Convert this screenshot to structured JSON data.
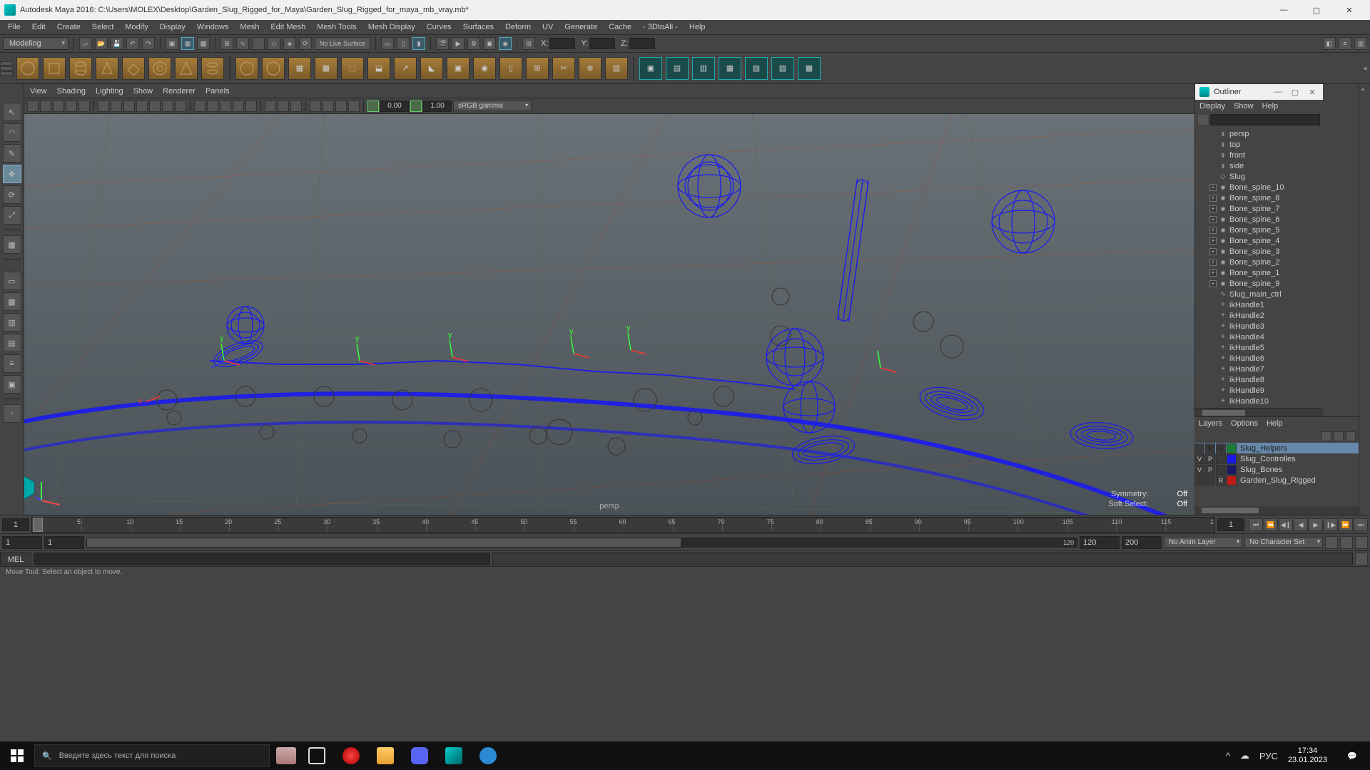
{
  "titlebar": {
    "title": "Autodesk Maya 2016: C:\\Users\\MOLEX\\Desktop\\Garden_Slug_Rigged_for_Maya\\Garden_Slug_Rigged_for_maya_mb_vray.mb*"
  },
  "main_menu": [
    "File",
    "Edit",
    "Create",
    "Select",
    "Modify",
    "Display",
    "Windows",
    "Mesh",
    "Edit Mesh",
    "Mesh Tools",
    "Mesh Display",
    "Curves",
    "Surfaces",
    "Deform",
    "UV",
    "Generate",
    "Cache",
    "- 3DtoAll -",
    "Help"
  ],
  "status": {
    "mode": "Modeling",
    "live": "No Live Surface",
    "coord_x": "X:",
    "coord_y": "Y:",
    "coord_z": "Z:",
    "x": "",
    "y": "",
    "z": ""
  },
  "viewport": {
    "menu": [
      "View",
      "Shading",
      "Lighting",
      "Show",
      "Renderer",
      "Panels"
    ],
    "num1": "0.00",
    "num2": "1.00",
    "colorspace": "sRGB gamma",
    "camera": "persp",
    "sym_label": "Symmetry:",
    "sym_val": "Off",
    "soft_label": "Soft Select:",
    "soft_val": "Off"
  },
  "outliner": {
    "title": "Outliner",
    "menu": [
      "Display",
      "Show",
      "Help"
    ],
    "cameras": [
      "persp",
      "top",
      "front",
      "side"
    ],
    "root": "Slug",
    "bones": [
      "Bone_spine_10",
      "Bone_spine_8",
      "Bone_spine_7",
      "Bone_spine_6",
      "Bone_spine_5",
      "Bone_spine_4",
      "Bone_spine_3",
      "Bone_spine_2",
      "Bone_spine_1",
      "Bone_spine_9"
    ],
    "ctrl": "Slug_main_ctrl",
    "iks": [
      "ikHandle1",
      "ikHandle2",
      "ikHandle3",
      "ikHandle4",
      "ikHandle5",
      "ikHandle6",
      "ikHandle7",
      "ikHandle8",
      "ikHandle9",
      "ikHandle10"
    ]
  },
  "layers": {
    "menu": [
      "Layers",
      "Options",
      "Help"
    ],
    "rows": [
      {
        "v": "",
        "p": "P",
        "r": "R",
        "color": "#1a7a3a",
        "name": "Slug_Helpers",
        "hl": true
      },
      {
        "v": "V",
        "p": "P",
        "r": "",
        "color": "#1a1aea",
        "name": "Slug_Controlles",
        "hl": false
      },
      {
        "v": "V",
        "p": "P",
        "r": "",
        "color": "#1a1a6a",
        "name": "Slug_Bones",
        "hl": false
      },
      {
        "v": "",
        "p": "",
        "r": "R",
        "color": "#c01a1a",
        "name": "Garden_Slug_Rigged",
        "hl": false
      }
    ]
  },
  "time": {
    "current": "1",
    "end": "1",
    "start_range": "1",
    "end_in": "1",
    "range_val": "120",
    "end_range": "120",
    "max_range": "200",
    "anim_layer": "No Anim Layer",
    "char_set": "No Character Set"
  },
  "cmd": {
    "lang": "MEL"
  },
  "help": "Move Tool: Select an object to move.",
  "taskbar": {
    "search_placeholder": "Введите здесь текст для поиска",
    "lang": "РУС",
    "time": "17:34",
    "date": "23.01.2023"
  }
}
